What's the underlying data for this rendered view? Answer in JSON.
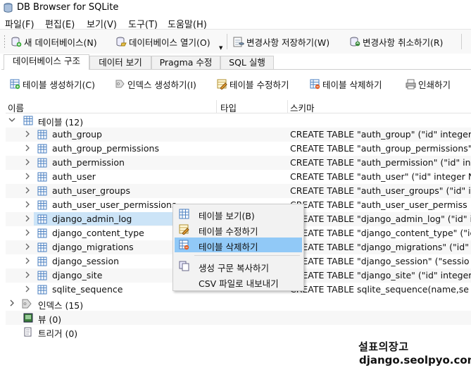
{
  "window": {
    "title": "DB Browser for SQLite"
  },
  "menu": [
    "파일(F)",
    "편집(E)",
    "보기(V)",
    "도구(T)",
    "도움말(H)"
  ],
  "toolbar": {
    "new_db": "새 데이터베이스(N)",
    "open_db": "데이터베이스 열기(O)",
    "write_changes": "변경사항 저장하기(W)",
    "revert_changes": "변경사항 취소하기(R)"
  },
  "tabs": [
    "데이터베이스 구조",
    "데이터 보기",
    "Pragma 수정",
    "SQL 실행"
  ],
  "structure_toolbar": {
    "create_table": "테이블 생성하기(C)",
    "create_index": "인덱스 생성하기(I)",
    "modify_table": "테이블 수정하기",
    "delete_table": "테이블 삭제하기",
    "print": "인쇄하기"
  },
  "columns": {
    "name": "이름",
    "type": "타입",
    "schema": "스키마"
  },
  "tree": {
    "tables_label": "테이블 (12)",
    "tables": [
      {
        "name": "auth_group",
        "schema": "CREATE TABLE \"auth_group\" (\"id\" integer"
      },
      {
        "name": "auth_group_permissions",
        "schema": "CREATE TABLE \"auth_group_permissions\""
      },
      {
        "name": "auth_permission",
        "schema": "CREATE TABLE \"auth_permission\" (\"id\" int"
      },
      {
        "name": "auth_user",
        "schema": "CREATE TABLE \"auth_user\" (\"id\" integer N"
      },
      {
        "name": "auth_user_groups",
        "schema": "CREATE TABLE \"auth_user_groups\" (\"id\" i"
      },
      {
        "name": "auth_user_user_permissions",
        "schema": "CREATE TABLE \"auth_user_user_permiss"
      },
      {
        "name": "django_admin_log",
        "schema": "CREATE TABLE \"django_admin_log\" (\"id\" int"
      },
      {
        "name": "django_content_type",
        "schema": "CREATE TABLE \"django_content_type\" (\"ic"
      },
      {
        "name": "django_migrations",
        "schema": "CREATE TABLE \"django_migrations\" (\"id\" i"
      },
      {
        "name": "django_session",
        "schema": "CREATE TABLE \"django_session\" (\"sessio"
      },
      {
        "name": "django_site",
        "schema": "CREATE TABLE \"django_site\" (\"id\" integer"
      },
      {
        "name": "sqlite_sequence",
        "schema": "CREATE TABLE sqlite_sequence(name,se"
      }
    ],
    "indices_label": "인덱스 (15)",
    "views_label": "뷰 (0)",
    "triggers_label": "트리거 (0)"
  },
  "context_menu": {
    "browse_table": "테이블 보기(B)",
    "modify_table": "테이블 수정하기",
    "delete_table": "테이블 삭제하기",
    "copy_create": "생성 구문 복사하기",
    "export_csv": "CSV 파일로 내보내기"
  },
  "watermark": {
    "line1": "설표의장고",
    "line2": "django.seolpyo.com"
  },
  "colors": {
    "selection": "#cce4f7",
    "menu_hover": "#91c9f7",
    "table_icon": "#4a7fc0"
  }
}
